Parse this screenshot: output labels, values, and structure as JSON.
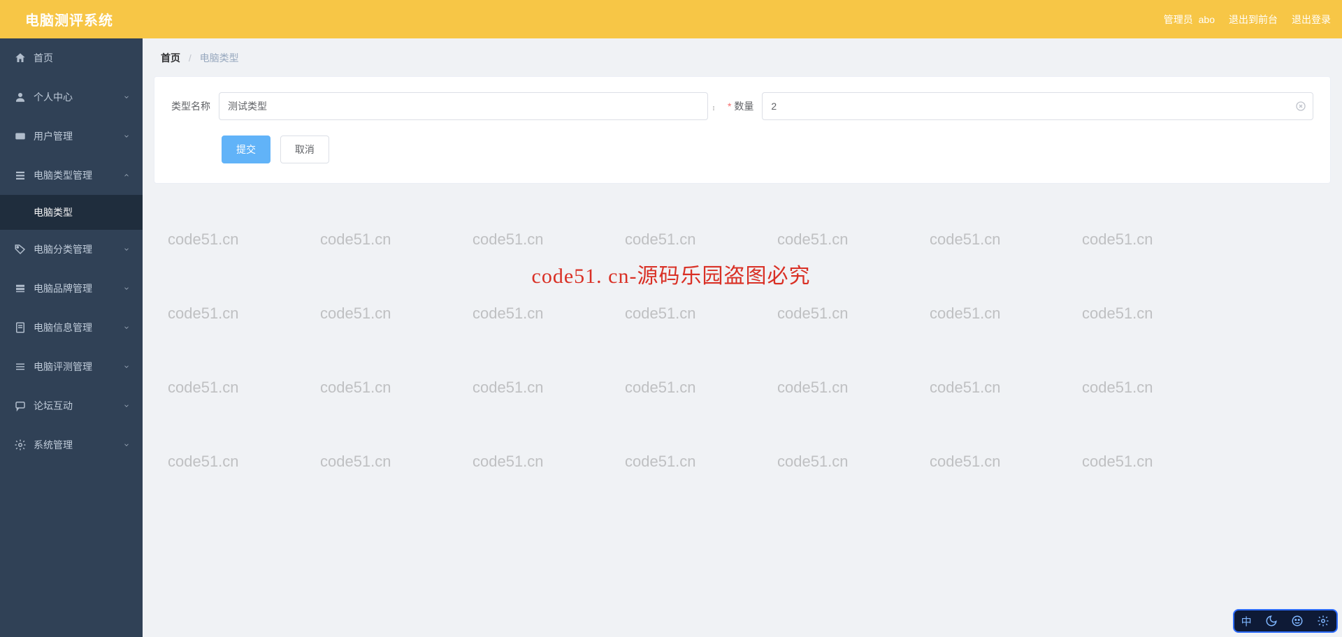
{
  "header": {
    "title": "电脑测评系统",
    "user_prefix": "管理员",
    "user_name": "abo",
    "exit_to_front": "退出到前台",
    "logout": "退出登录"
  },
  "sidebar": {
    "items": [
      {
        "label": "首页",
        "icon": "home",
        "expandable": false
      },
      {
        "label": "个人中心",
        "icon": "user",
        "expandable": true
      },
      {
        "label": "用户管理",
        "icon": "card",
        "expandable": true
      },
      {
        "label": "电脑类型管理",
        "icon": "list",
        "expandable": true,
        "open": true,
        "children": [
          {
            "label": "电脑类型",
            "active": true
          }
        ]
      },
      {
        "label": "电脑分类管理",
        "icon": "tag",
        "expandable": true
      },
      {
        "label": "电脑品牌管理",
        "icon": "stack",
        "expandable": true
      },
      {
        "label": "电脑信息管理",
        "icon": "doc",
        "expandable": true
      },
      {
        "label": "电脑评测管理",
        "icon": "bars",
        "expandable": true
      },
      {
        "label": "论坛互动",
        "icon": "chat",
        "expandable": true
      },
      {
        "label": "系统管理",
        "icon": "gear",
        "expandable": true
      }
    ]
  },
  "breadcrumb": {
    "home": "首页",
    "current": "电脑类型"
  },
  "form": {
    "type_name_label": "类型名称",
    "type_name_value": "测试类型",
    "quantity_label": "数量",
    "quantity_required": true,
    "quantity_value": "2",
    "submit": "提交",
    "cancel": "取消"
  },
  "watermark": {
    "small": "code51.cn",
    "big": "code51. cn-源码乐园盗图必究"
  },
  "ime": {
    "lang": "中"
  }
}
